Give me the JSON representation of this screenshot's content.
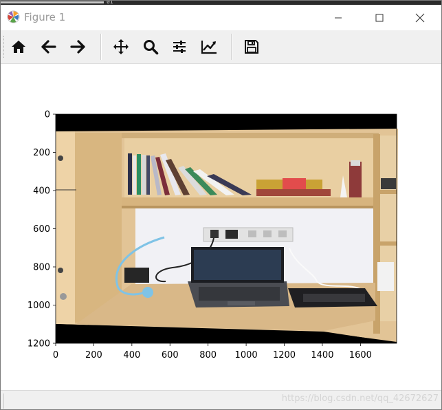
{
  "window": {
    "title": "Figure 1",
    "terminal_strip_text": "01"
  },
  "titlebar_buttons": [
    {
      "name": "minimize-button",
      "icon": "minimize-icon"
    },
    {
      "name": "maximize-button",
      "icon": "maximize-icon"
    },
    {
      "name": "close-button",
      "icon": "close-icon"
    }
  ],
  "toolbar": {
    "buttons": [
      {
        "name": "home-button",
        "icon": "home-icon"
      },
      {
        "name": "back-button",
        "icon": "arrow-left-icon"
      },
      {
        "name": "forward-button",
        "icon": "arrow-right-icon"
      },
      {
        "name": "pan-button",
        "icon": "move-icon"
      },
      {
        "name": "zoom-button",
        "icon": "magnifier-icon"
      },
      {
        "name": "subplots-button",
        "icon": "sliders-icon"
      },
      {
        "name": "edit-axes-button",
        "icon": "line-chart-icon"
      },
      {
        "name": "save-button",
        "icon": "floppy-disk-icon"
      }
    ]
  },
  "statusbar": {
    "watermark": "https://blog.csdn.net/qq_42672627"
  },
  "chart_data": {
    "type": "image",
    "xticks": [
      "0",
      "200",
      "400",
      "600",
      "800",
      "1000",
      "1200",
      "1400",
      "1600"
    ],
    "yticks": [
      "0",
      "200",
      "400",
      "600",
      "800",
      "1000",
      "1200"
    ],
    "xlim": [
      0,
      1790
    ],
    "ylim": [
      1200,
      0
    ],
    "colors": {
      "border": "#000000",
      "wood": "#e3c597",
      "wall": "#f1f1f4",
      "laptop": "#3a3c40"
    }
  }
}
